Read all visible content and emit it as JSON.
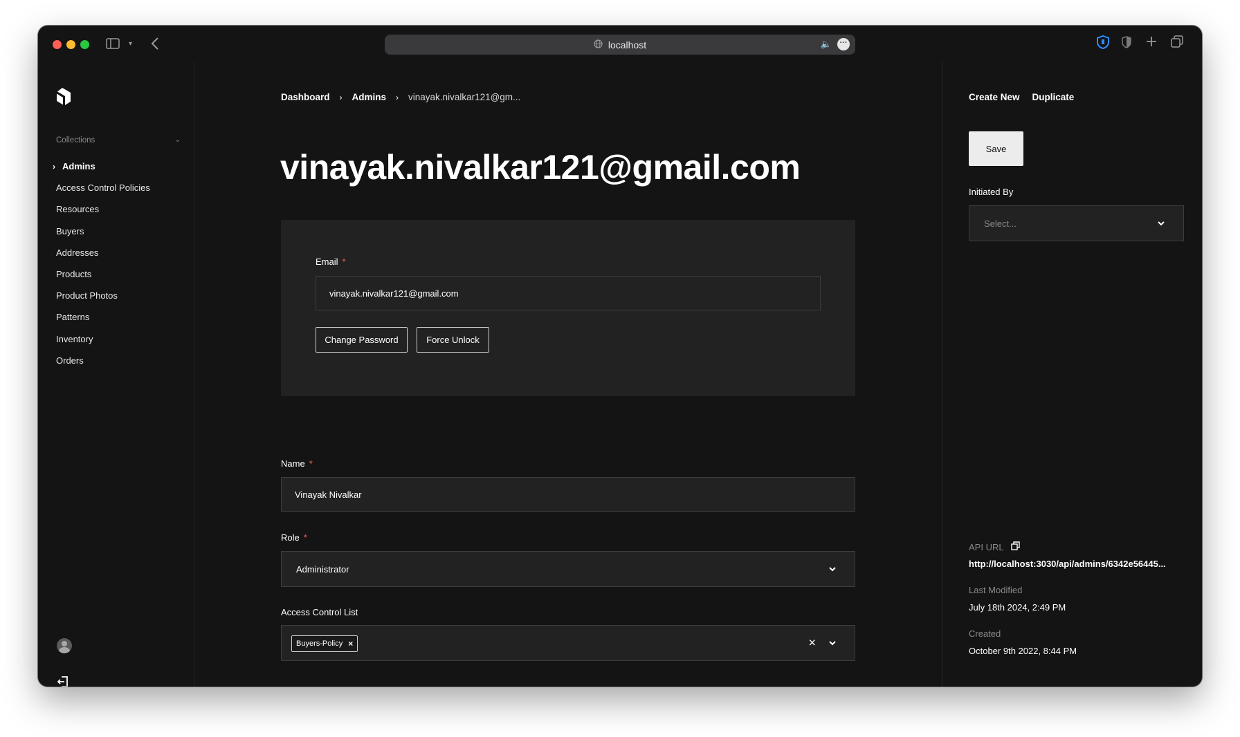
{
  "browser": {
    "url": "localhost"
  },
  "sidebar": {
    "collections_label": "Collections",
    "items": [
      {
        "label": "Admins"
      },
      {
        "label": "Access Control Policies"
      },
      {
        "label": "Resources"
      },
      {
        "label": "Buyers"
      },
      {
        "label": "Addresses"
      },
      {
        "label": "Products"
      },
      {
        "label": "Product Photos"
      },
      {
        "label": "Patterns"
      },
      {
        "label": "Inventory"
      },
      {
        "label": "Orders"
      }
    ]
  },
  "breadcrumb": {
    "items": [
      "Dashboard",
      "Admins"
    ],
    "current": "vinayak.nivalkar121@gm..."
  },
  "page_title": "vinayak.nivalkar121@gmail.com",
  "form": {
    "email": {
      "label": "Email",
      "required": "*",
      "value": "vinayak.nivalkar121@gmail.com"
    },
    "change_password_label": "Change Password",
    "force_unlock_label": "Force Unlock",
    "name": {
      "label": "Name",
      "required": "*",
      "value": "Vinayak Nivalkar"
    },
    "role": {
      "label": "Role",
      "required": "*",
      "value": "Administrator"
    },
    "acl": {
      "label": "Access Control List",
      "tags": [
        "Buyers-Policy"
      ]
    }
  },
  "right_panel": {
    "create_new_label": "Create New",
    "duplicate_label": "Duplicate",
    "save_label": "Save",
    "initiated_by": {
      "label": "Initiated By",
      "placeholder": "Select..."
    },
    "api_url": {
      "label": "API URL",
      "value": "http://localhost:3030/api/admins/6342e56445..."
    },
    "last_modified": {
      "label": "Last Modified",
      "value": "July 18th 2024, 2:49 PM"
    },
    "created": {
      "label": "Created",
      "value": "October 9th 2022, 8:44 PM"
    }
  },
  "colors": {
    "background": "#141414",
    "panel": "#222222",
    "required": "#ff5c5c",
    "text": "#ffffff"
  }
}
